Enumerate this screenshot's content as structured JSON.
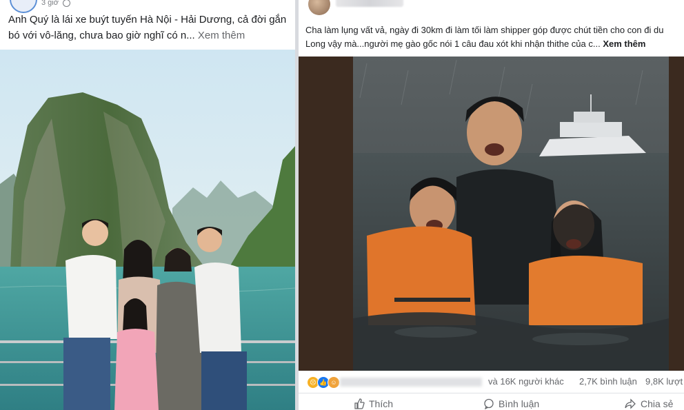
{
  "left_post": {
    "time": "3 giờ",
    "caption": "Anh Quý là lái xe buýt tuyến Hà Nội - Hải Dương, cả đời gắn bó với vô-lăng, chưa bao giờ nghĩ có n...",
    "see_more": "Xem thêm"
  },
  "right_post": {
    "caption_line1": "Cha làm lụng vất vả, ngày đi 30km đi làm tối làm shipper góp được chút tiền cho con đi du",
    "caption_line2": "Long vậy mà...người mẹ gào gốc nói 1 câu đau xót khi nhận thithe của c...",
    "see_more": "Xem thêm",
    "reactions": {
      "icons": [
        "sad",
        "like",
        "haha"
      ],
      "others": "và 16K người khác",
      "comments": "2,7K bình luận",
      "shares": "9,8K lượt"
    },
    "actions": {
      "like": "Thích",
      "comment": "Bình luận",
      "share": "Chia sẻ"
    }
  },
  "colors": {
    "like_blue": "#1877f2",
    "sad_yellow": "#f7b125",
    "haha_orange": "#f0a23a",
    "secondary_text": "#65676b"
  }
}
